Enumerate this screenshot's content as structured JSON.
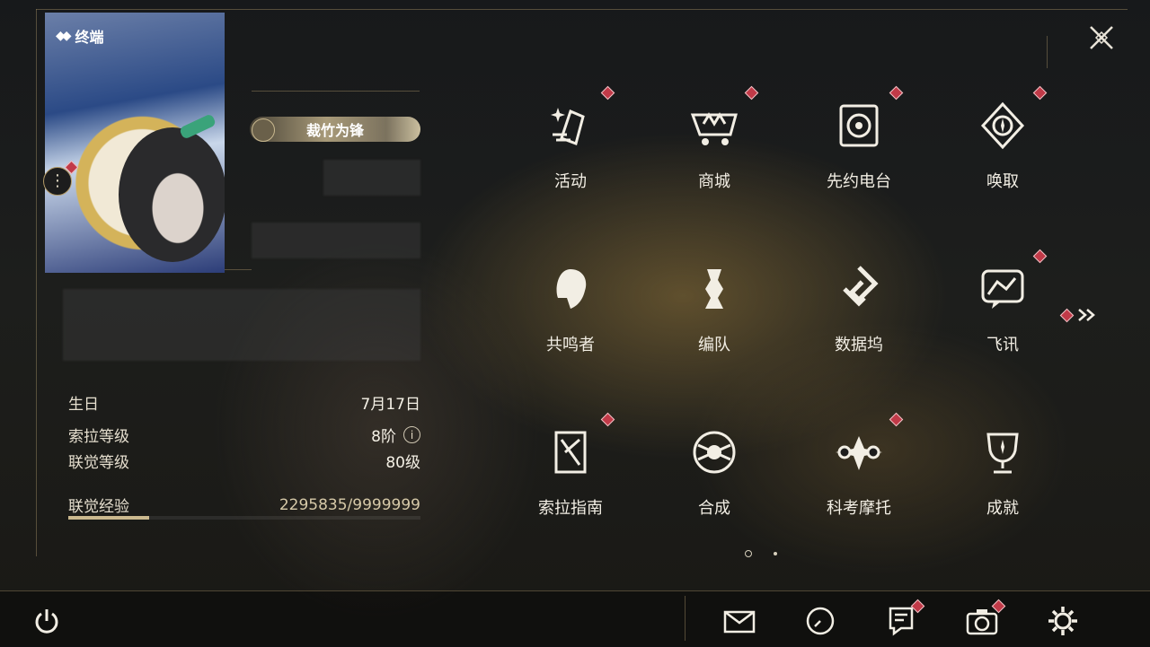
{
  "terminal_title": "终端",
  "title_badge": "裁竹为锋",
  "stats": {
    "birthday_label": "生日",
    "birthday_value": "7月17日",
    "sola_level_label": "索拉等级",
    "sola_level_value": "8阶",
    "union_level_label": "联觉等级",
    "union_level_value": "80级",
    "union_exp_label": "联觉经验",
    "union_exp_value": "2295835/9999999",
    "union_exp_fraction": 0.2296
  },
  "features": [
    {
      "label": "活动",
      "icon": "events-icon",
      "badge": true
    },
    {
      "label": "商城",
      "icon": "shop-icon",
      "badge": true
    },
    {
      "label": "先约电台",
      "icon": "radio-icon",
      "badge": true
    },
    {
      "label": "唤取",
      "icon": "convene-icon",
      "badge": true
    },
    {
      "label": "共鸣者",
      "icon": "resonator-icon",
      "badge": false
    },
    {
      "label": "编队",
      "icon": "team-icon",
      "badge": false
    },
    {
      "label": "数据坞",
      "icon": "data-bank-icon",
      "badge": false
    },
    {
      "label": "飞讯",
      "icon": "messages-icon",
      "badge": true
    },
    {
      "label": "索拉指南",
      "icon": "guidebook-icon",
      "badge": true
    },
    {
      "label": "合成",
      "icon": "synthesis-icon",
      "badge": false
    },
    {
      "label": "科考摩托",
      "icon": "motorbike-icon",
      "badge": true
    },
    {
      "label": "成就",
      "icon": "achievement-icon",
      "badge": false
    }
  ],
  "pager": {
    "current": 1,
    "total": 2
  },
  "bottom_bar": [
    {
      "name": "mail-icon",
      "badge": false
    },
    {
      "name": "clock-icon",
      "badge": false
    },
    {
      "name": "notice-icon",
      "badge": true
    },
    {
      "name": "camera-icon",
      "badge": true
    },
    {
      "name": "settings-icon",
      "badge": false
    }
  ],
  "colors": {
    "accent_gold": "#cbb98e",
    "badge_red": "#c13a48",
    "text_light": "#f2eee4"
  }
}
